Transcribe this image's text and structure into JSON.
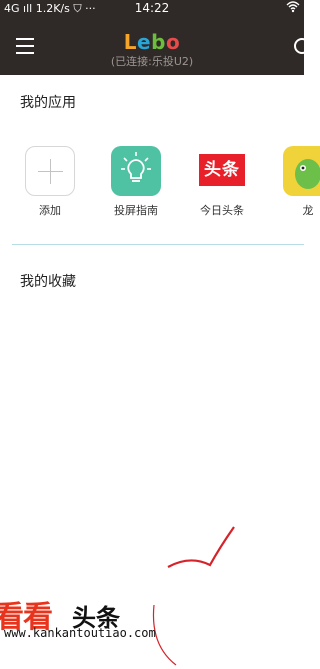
{
  "status_bar": {
    "network": "4G",
    "speed": "1.2K/s",
    "more": "···",
    "time": "14:22"
  },
  "header": {
    "logo": [
      "L",
      "e",
      "b",
      "o"
    ],
    "logo_colors": [
      "#f4a52a",
      "#2aa6d6",
      "#6bbf3c",
      "#e94b4b"
    ],
    "subtitle": "(已连接:乐投U2)",
    "background": "#2f2a27"
  },
  "my_apps": {
    "title": "我的应用",
    "items": [
      {
        "label": "添加",
        "icon": "add-icon"
      },
      {
        "label": "投屏指南",
        "icon": "lightbulb-icon"
      },
      {
        "label": "今日头条",
        "icon": "toutiao-icon",
        "badge": "头条"
      },
      {
        "label": "龙",
        "icon": "dragon-game-icon"
      }
    ]
  },
  "favorites": {
    "title": "我的收藏"
  },
  "watermark": {
    "brand": "看看",
    "suffix": "头条",
    "url": "www.kankantoutiao.com"
  }
}
